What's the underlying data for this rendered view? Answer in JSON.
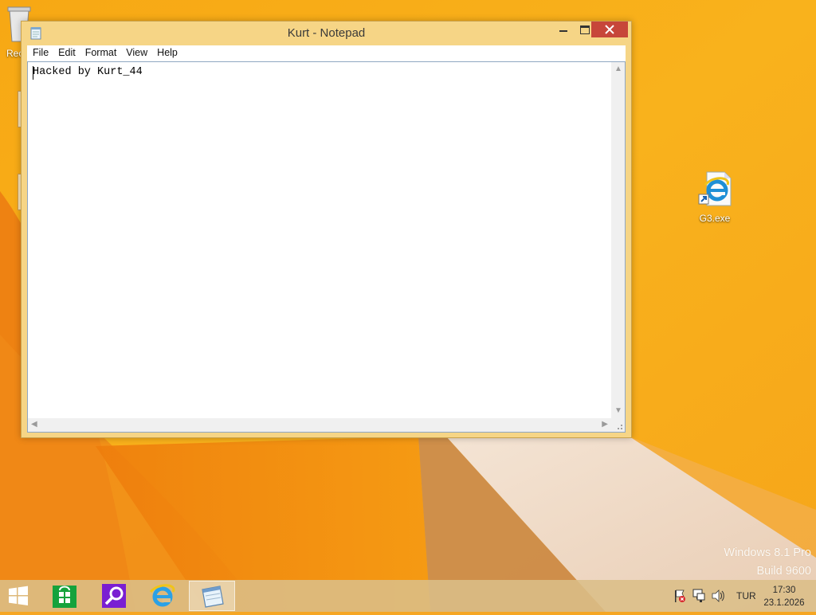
{
  "desktop": {
    "partial_icon_label": "Rec",
    "shortcut_icon": {
      "label": "G3.exe",
      "icon": "internet-explorer-icon"
    },
    "watermark": {
      "line1": "Windows 8.1 Pro",
      "line2": "Build 9600"
    }
  },
  "window": {
    "title": "Kurt - Notepad",
    "menu": [
      "File",
      "Edit",
      "Format",
      "View",
      "Help"
    ],
    "content": "Hacked by Kurt_44"
  },
  "taskbar": {
    "items": [
      {
        "name": "start-button",
        "icon": "windows-logo-icon"
      },
      {
        "name": "store",
        "icon": "store-icon"
      },
      {
        "name": "search",
        "icon": "search-icon"
      },
      {
        "name": "internet-explorer",
        "icon": "internet-explorer-icon"
      },
      {
        "name": "notepad",
        "icon": "notepad-icon",
        "active": true
      }
    ],
    "tray": {
      "icons": [
        "action-center-flag-icon",
        "network-icon",
        "volume-icon"
      ],
      "language": "TUR",
      "time": "17:30",
      "date": "23.1.2026"
    }
  },
  "colors": {
    "wallpaper": "#f5a623",
    "window_frame": "#f6d586",
    "close_button": "#c7463a",
    "taskbar": "#dbbe87"
  }
}
